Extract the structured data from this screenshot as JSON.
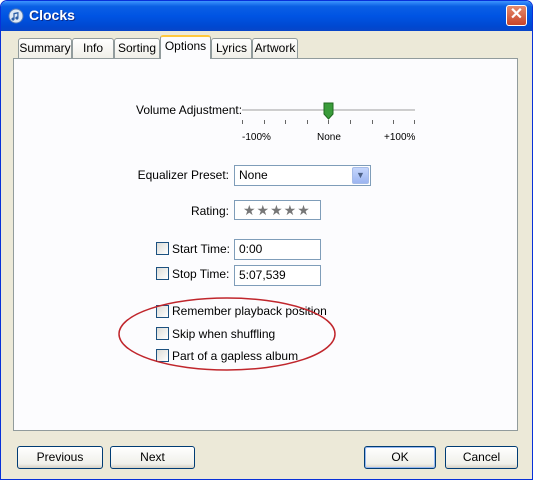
{
  "window": {
    "title": "Clocks"
  },
  "tabs": [
    {
      "label": "Summary"
    },
    {
      "label": "Info"
    },
    {
      "label": "Sorting"
    },
    {
      "label": "Options"
    },
    {
      "label": "Lyrics"
    },
    {
      "label": "Artwork"
    }
  ],
  "active_tab": "Options",
  "volume": {
    "label": "Volume Adjustment:",
    "min_label": "-100%",
    "mid_label": "None",
    "max_label": "+100%",
    "value_percent": 0
  },
  "equalizer": {
    "label": "Equalizer Preset:",
    "value": "None"
  },
  "rating": {
    "label": "Rating:",
    "stars": "★★★★★",
    "value": 0
  },
  "start_time": {
    "label": "Start Time:",
    "value": "0:00",
    "checked": false
  },
  "stop_time": {
    "label": "Stop Time:",
    "value": "5:07,539",
    "checked": false
  },
  "options": [
    {
      "label": "Remember playback position",
      "checked": false
    },
    {
      "label": "Skip when shuffling",
      "checked": false
    },
    {
      "label": "Part of a gapless album",
      "checked": false
    }
  ],
  "annotation": {
    "color": "#c0262c"
  },
  "buttons": {
    "previous": "Previous",
    "next": "Next",
    "ok": "OK",
    "cancel": "Cancel"
  }
}
